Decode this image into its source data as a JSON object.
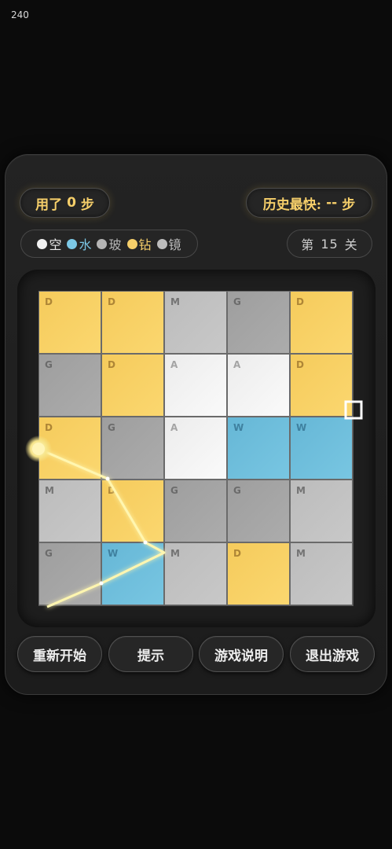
{
  "fps_counter": "240",
  "header": {
    "steps_prefix": "用了",
    "steps_value": "0",
    "steps_suffix": "步",
    "best_prefix": "历史最快:",
    "best_value": "--",
    "best_suffix": "步"
  },
  "legend": [
    {
      "label": "空",
      "color": "#f2f2f2",
      "text_color": "#e8e8e8"
    },
    {
      "label": "水",
      "color": "#7cc8e6",
      "text_color": "#7cc8e6"
    },
    {
      "label": "玻",
      "color": "#b5b5b5",
      "text_color": "#b5b5b5"
    },
    {
      "label": "钻",
      "color": "#f6cf6a",
      "text_color": "#f6cf6a"
    },
    {
      "label": "镜",
      "color": "#bdbdbd",
      "text_color": "#bdbdbd"
    }
  ],
  "level": {
    "prefix": "第",
    "number": "15",
    "suffix": "关"
  },
  "grid": [
    [
      "D",
      "D",
      "M",
      "G",
      "D"
    ],
    [
      "G",
      "D",
      "A",
      "A",
      "D"
    ],
    [
      "D",
      "G",
      "A",
      "W",
      "W"
    ],
    [
      "M",
      "D",
      "G",
      "G",
      "M"
    ],
    [
      "G",
      "W",
      "M",
      "D",
      "M"
    ]
  ],
  "beam_color": "#fff6b0",
  "buttons": [
    {
      "label": "重新开始",
      "name": "restart-button"
    },
    {
      "label": "提示",
      "name": "hint-button"
    },
    {
      "label": "游戏说明",
      "name": "instructions-button"
    },
    {
      "label": "退出游戏",
      "name": "exit-game-button"
    }
  ]
}
